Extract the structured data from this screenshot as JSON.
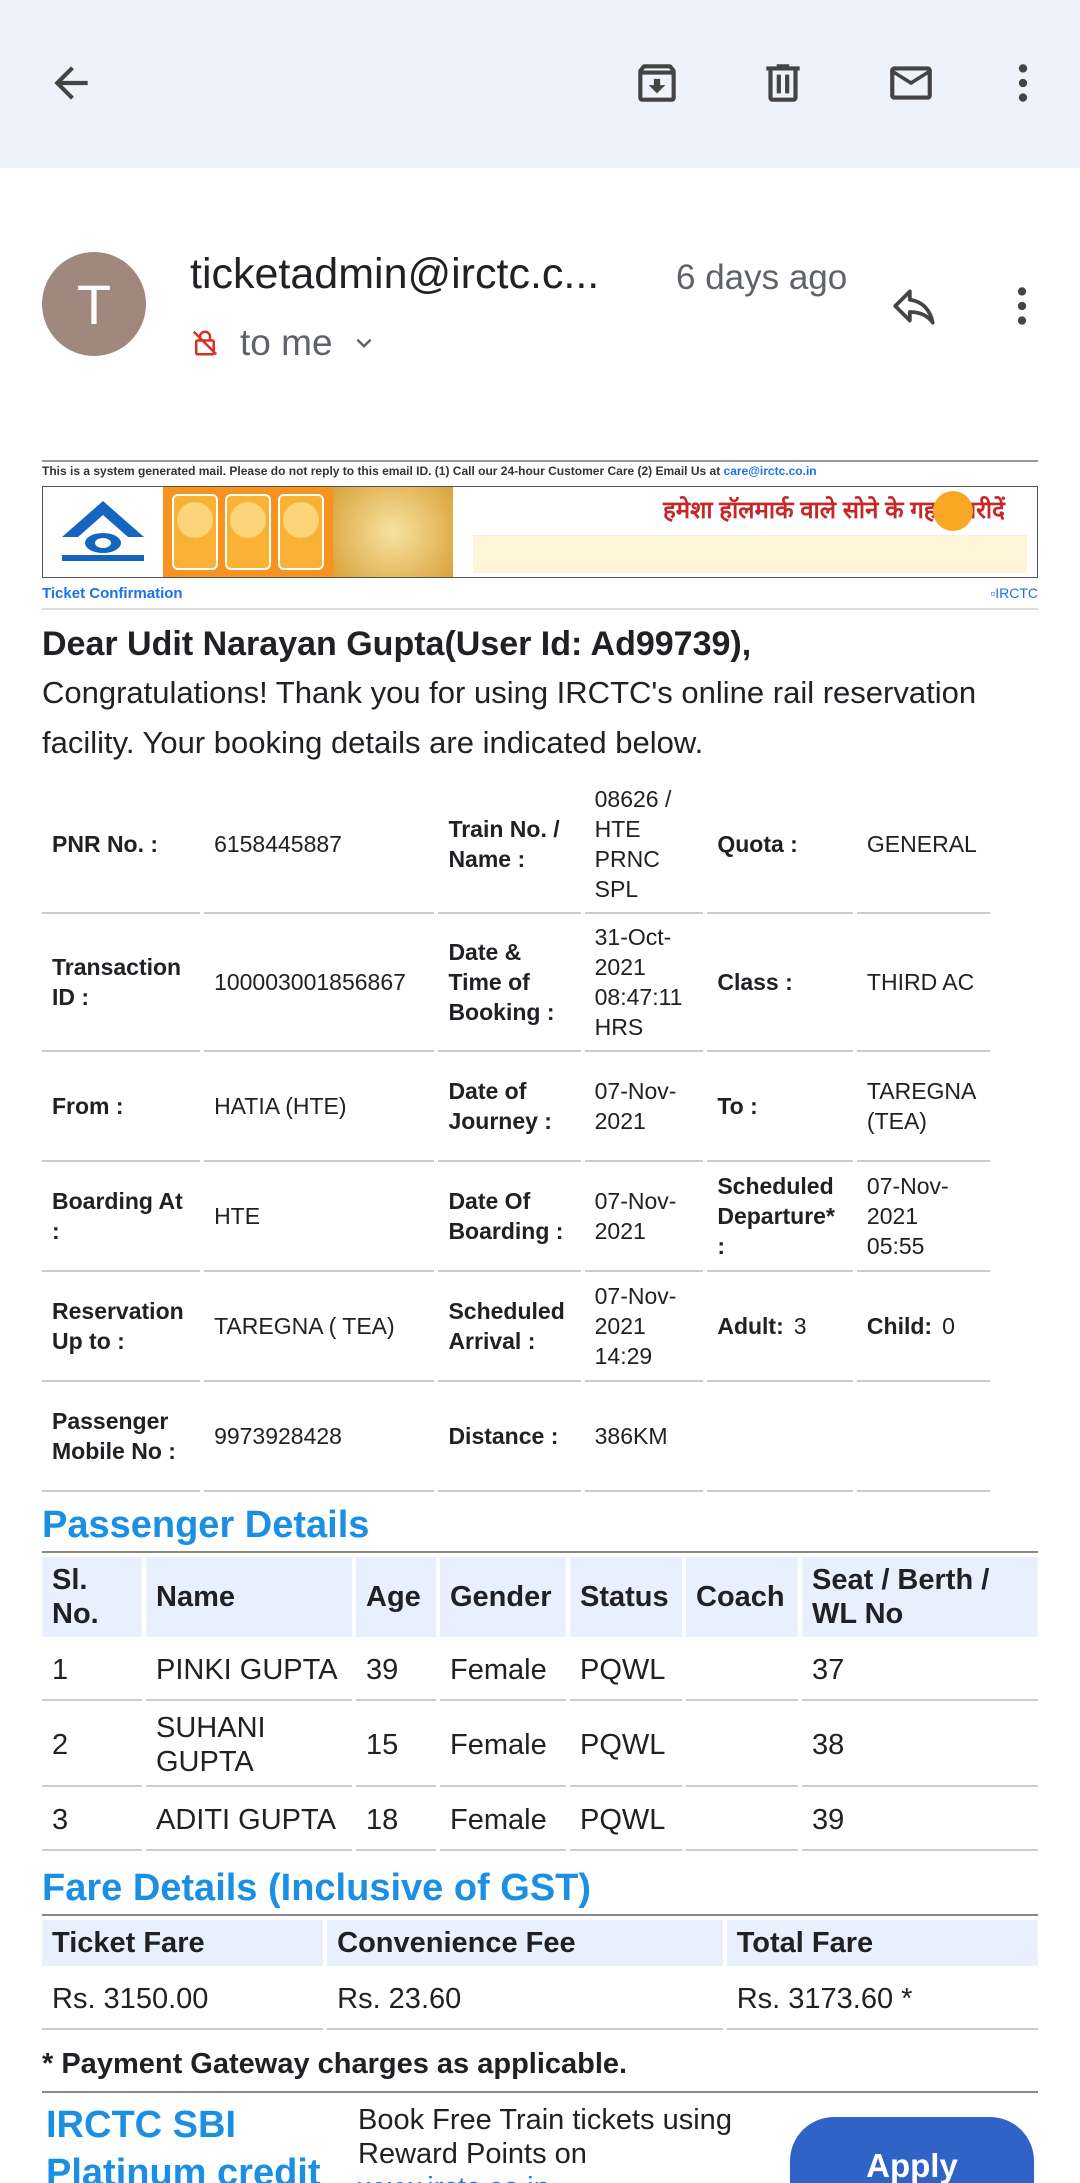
{
  "toolbar": {
    "back": "back-arrow",
    "archive": "archive",
    "delete": "delete",
    "mark_unread": "mark-unread",
    "more": "more-vertical"
  },
  "header": {
    "avatar_letter": "T",
    "avatar_color": "#a1887f",
    "sender": "ticketadmin@irctc.c...",
    "time": "6 days ago",
    "recipient": "to me"
  },
  "email": {
    "system_note": "This is a system generated mail. Please do not reply to this email ID. (1) Call our 24-hour Customer Care (2) Email Us at ",
    "system_email": "care@irctc.co.in",
    "banner_text": "हमेशा हॉलमार्क वाले सोने के गहने खरीदें",
    "ticket_title": "Ticket Confirmation",
    "logo_alt": "IRCTC",
    "greeting": "Dear Udit Narayan Gupta(User Id: Ad99739),",
    "intro": "Congratulations! Thank you for using IRCTC's online rail reservation facility. Your booking details are indicated below."
  },
  "booking": [
    [
      "PNR No. :",
      "6158445887",
      "Train No. / Name :",
      "08626 / HTE PRNC SPL",
      "Quota :",
      "GENERAL"
    ],
    [
      "Transaction ID :",
      "100003001856867",
      "Date & Time of Booking :",
      "31-Oct-2021 08:47:11 HRS",
      "Class :",
      "THIRD AC"
    ],
    [
      "From :",
      "HATIA (HTE)",
      "Date of Journey :",
      "07-Nov-2021",
      "To :",
      "TAREGNA (TEA)"
    ],
    [
      "Boarding At :",
      "HTE",
      "Date Of Boarding :",
      "07-Nov-2021",
      "Scheduled Departure* :",
      "07-Nov-2021 05:55"
    ],
    [
      "Reservation Up to :",
      "TAREGNA ( TEA)",
      "Scheduled Arrival :",
      "07-Nov-2021 14:29",
      "Adult:",
      "3",
      "Child:",
      "0"
    ],
    [
      "Passenger Mobile No :",
      "9973928428",
      "Distance :",
      "386KM"
    ]
  ],
  "passengers": {
    "title": "Passenger Details",
    "headers": [
      "Sl. No.",
      "Name",
      "Age",
      "Gender",
      "Status",
      "Coach",
      "Seat / Berth / WL No"
    ],
    "rows": [
      [
        "1",
        "PINKI GUPTA",
        "39",
        "Female",
        "PQWL",
        "",
        "37"
      ],
      [
        "2",
        "SUHANI GUPTA",
        "15",
        "Female",
        "PQWL",
        "",
        "38"
      ],
      [
        "3",
        "ADITI GUPTA",
        "18",
        "Female",
        "PQWL",
        "",
        "39"
      ]
    ]
  },
  "fare": {
    "title": "Fare Details (Inclusive of GST)",
    "headers": [
      "Ticket Fare",
      "Convenience Fee",
      "Total Fare"
    ],
    "values": [
      "Rs. 3150.00",
      "Rs. 23.60",
      "Rs. 3173.60 *"
    ],
    "note": "* Payment Gateway charges as applicable."
  },
  "promo": {
    "brand": "IRCTC SBI Platinum credit",
    "text": "Book Free Train tickets using Reward Points on",
    "link": "www.irctc.co.in",
    "button": "Apply",
    "button_color": "#2f63c6"
  }
}
